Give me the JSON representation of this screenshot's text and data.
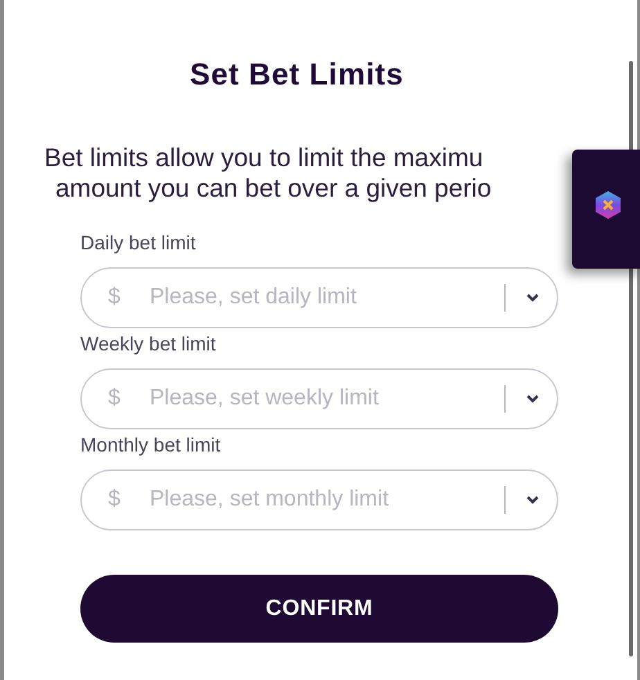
{
  "title": "Set Bet Limits",
  "description_lines": [
    "Bet limits allow you to limit the maximu",
    "amount you can bet over a given perio"
  ],
  "fields": [
    {
      "label": "Daily bet limit",
      "currency": "$",
      "placeholder": "Please, set daily limit"
    },
    {
      "label": "Weekly bet limit",
      "currency": "$",
      "placeholder": "Please, set weekly limit"
    },
    {
      "label": "Monthly bet limit",
      "currency": "$",
      "placeholder": "Please, set monthly limit"
    }
  ],
  "confirm_button": "CONFIRM"
}
